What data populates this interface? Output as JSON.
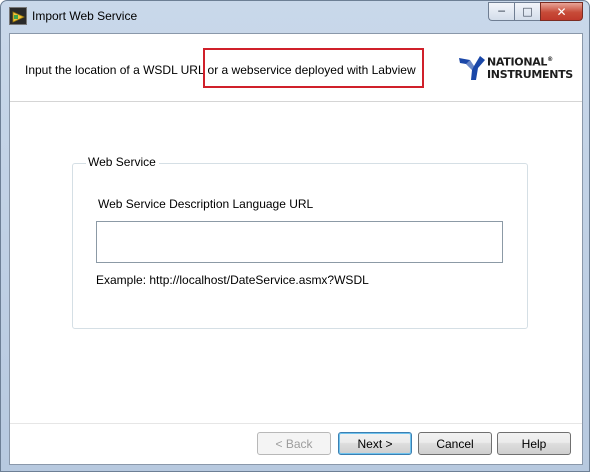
{
  "window": {
    "title": "Import Web Service",
    "controls": {
      "minimize": "─",
      "maximize": "□",
      "close": "✕"
    }
  },
  "header": {
    "instruction": "Input the location of a WSDL URL or a  webservice deployed with Labview",
    "logo_line1": "NATIONAL",
    "logo_line2": "INSTRUMENTS",
    "logo_trademark": "®",
    "highlight_color": "#d0202a"
  },
  "group": {
    "legend": "Web Service",
    "field_label": "Web Service Description Language URL",
    "url_value": "",
    "example": "Example: http://localhost/DateService.asmx?WSDL"
  },
  "buttons": {
    "back": "< Back",
    "next": "Next >",
    "cancel": "Cancel",
    "help": "Help"
  },
  "icons": {
    "app": "labview-icon",
    "logo": "national-instruments-eagle-icon"
  }
}
